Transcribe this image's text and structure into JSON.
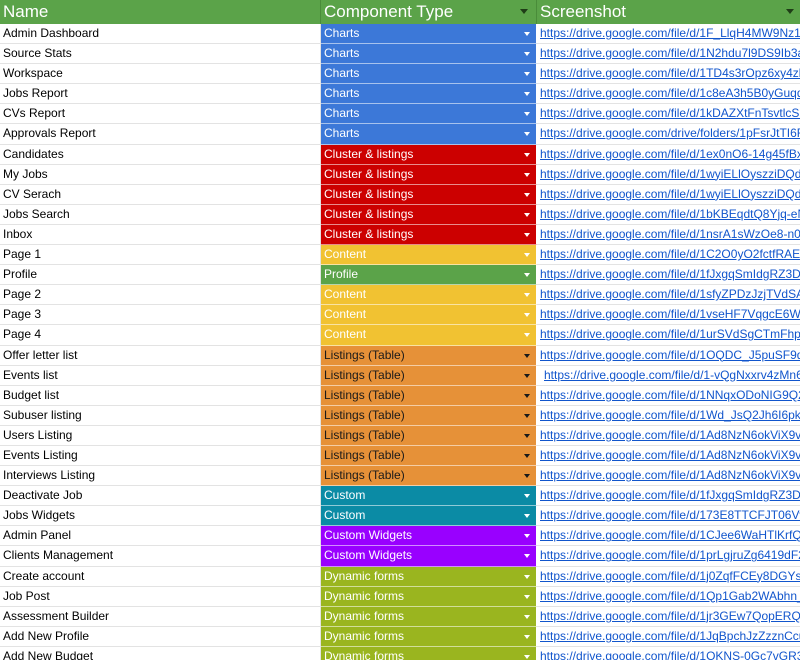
{
  "headers": {
    "name": "Name",
    "type": "Component Type",
    "screenshot": "Screenshot"
  },
  "colors": {
    "header_bg": "#5ba349",
    "Charts": "#3c78d8",
    "Cluster & listings": "#cc0000",
    "Content": "#f1c232",
    "Profile": "#5ba349",
    "Listings (Table)": "#e69138",
    "Custom": "#0b8ba5",
    "Custom Widgets": "#9900ff",
    "Dynamic forms": "#9ab51f",
    "link": "#1155cc"
  },
  "rows": [
    {
      "name": "Admin Dashboard",
      "type": "Charts",
      "link": "https://drive.google.com/file/d/1F_LlqH4MW9Nz1x"
    },
    {
      "name": "Source Stats",
      "type": "Charts",
      "link": "https://drive.google.com/file/d/1N2hdu7l9DS9Ib3a"
    },
    {
      "name": "Workspace",
      "type": "Charts",
      "link": "https://drive.google.com/file/d/1TD4s3rOpz6xy4zb"
    },
    {
      "name": "Jobs Report",
      "type": "Charts",
      "link": "https://drive.google.com/file/d/1c8eA3h5B0yGuqqp"
    },
    {
      "name": "CVs Report",
      "type": "Charts",
      "link": "https://drive.google.com/file/d/1kDAZXtFnTsvtlcSS"
    },
    {
      "name": "Approvals Report",
      "type": "Charts",
      "link": "https://drive.google.com/drive/folders/1pFsrJtTI6FU"
    },
    {
      "name": "Candidates",
      "type": "Cluster & listings",
      "link": "https://drive.google.com/file/d/1ex0nO6-14g45fBxv"
    },
    {
      "name": "My Jobs",
      "type": "Cluster & listings",
      "link": "https://drive.google.com/file/d/1wyiELlOyszziDQdK"
    },
    {
      "name": "CV Serach",
      "type": "Cluster & listings",
      "link": "https://drive.google.com/file/d/1wyiELlOyszziDQdK"
    },
    {
      "name": "Jobs Search",
      "type": "Cluster & listings",
      "link": "https://drive.google.com/file/d/1bKBEqdtQ8Yjq-eN"
    },
    {
      "name": "Inbox",
      "type": "Cluster & listings",
      "link": "https://drive.google.com/file/d/1nsrA1sWzOe8-n0iE"
    },
    {
      "name": "Page 1",
      "type": "Content",
      "link": "https://drive.google.com/file/d/1C2O0yO2fctfRAE4"
    },
    {
      "name": "Profile",
      "type": "Profile",
      "link": "https://drive.google.com/file/d/1fJxgqSmIdgRZ3D5"
    },
    {
      "name": "Page 2",
      "type": "Content",
      "link": "https://drive.google.com/file/d/1sfyZPDzJzjTVdSAY"
    },
    {
      "name": "Page 3",
      "type": "Content",
      "link": "https://drive.google.com/file/d/1vseHF7VqgcE6WU"
    },
    {
      "name": "Page 4",
      "type": "Content",
      "link": "https://drive.google.com/file/d/1urSVdSgCTmFhpk"
    },
    {
      "name": "Offer letter list",
      "type": "Listings (Table)",
      "link": "https://drive.google.com/file/d/1OQDC_J5puSF9dC"
    },
    {
      "name": "Events list",
      "type": "Listings (Table)",
      "link": "https://drive.google.com/file/d/1-vQgNxxrv4zMn6u",
      "indent": true
    },
    {
      "name": "Budget list",
      "type": "Listings (Table)",
      "link": "https://drive.google.com/file/d/1NNqxODoNIG9Q2("
    },
    {
      "name": "Subuser listing",
      "type": "Listings (Table)",
      "link": "https://drive.google.com/file/d/1Wd_JsQ2Jh6I6pkJ"
    },
    {
      "name": "Users Listing",
      "type": "Listings (Table)",
      "link": "https://drive.google.com/file/d/1Ad8NzN6okViX9vX"
    },
    {
      "name": "Events Listing",
      "type": "Listings (Table)",
      "link": "https://drive.google.com/file/d/1Ad8NzN6okViX9vX"
    },
    {
      "name": "Interviews Listing",
      "type": "Listings (Table)",
      "link": "https://drive.google.com/file/d/1Ad8NzN6okViX9vX"
    },
    {
      "name": "Deactivate Job",
      "type": "Custom",
      "link": "https://drive.google.com/file/d/1fJxgqSmIdgRZ3D5"
    },
    {
      "name": "Jobs Widgets",
      "type": "Custom",
      "link": "https://drive.google.com/file/d/173E8TTCFJT06Vw"
    },
    {
      "name": "Admin Panel",
      "type": "Custom Widgets",
      "link": "https://drive.google.com/file/d/1CJee6WaHTlKrfQX"
    },
    {
      "name": "Clients Management",
      "type": "Custom Widgets",
      "link": "https://drive.google.com/file/d/1prLgjruZg6419dF2c"
    },
    {
      "name": "Create account",
      "type": "Dynamic forms",
      "link": "https://drive.google.com/file/d/1j0ZqfFCEy8DGYsF"
    },
    {
      "name": "Job Post",
      "type": "Dynamic forms",
      "link": "https://drive.google.com/file/d/1Qp1Gab2WAbhn_Z"
    },
    {
      "name": "Assessment Builder",
      "type": "Dynamic forms",
      "link": "https://drive.google.com/file/d/1jr3GEw7QopERQz"
    },
    {
      "name": "Add New Profile",
      "type": "Dynamic forms",
      "link": "https://drive.google.com/file/d/1JqBpchJzZzznCcul"
    },
    {
      "name": "Add New Budget",
      "type": "Dynamic forms",
      "link": "https://drive.google.com/file/d/1OKNS-0Gc7vGR3I"
    }
  ]
}
